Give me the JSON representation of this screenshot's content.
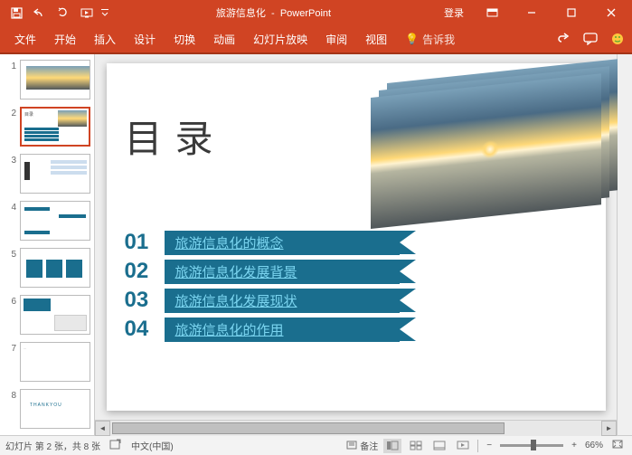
{
  "app": {
    "document_title": "旅游信息化",
    "app_name": "PowerPoint",
    "login": "登录"
  },
  "ribbon": {
    "tabs": [
      "文件",
      "开始",
      "插入",
      "设计",
      "切换",
      "动画",
      "幻灯片放映",
      "审阅",
      "视图"
    ],
    "tell_me": "告诉我"
  },
  "thumbnails": {
    "count": 8,
    "active": 2
  },
  "slide": {
    "title": "目录",
    "toc": [
      {
        "num": "01",
        "text": "旅游信息化的概念"
      },
      {
        "num": "02",
        "text": "旅游信息化发展背景"
      },
      {
        "num": "03",
        "text": "旅游信息化发展现状"
      },
      {
        "num": "04",
        "text": "旅游信息化的作用"
      }
    ]
  },
  "status": {
    "slide_info": "幻灯片 第 2 张，共 8 张",
    "language": "中文(中国)",
    "notes": "备注",
    "zoom": "66%"
  }
}
